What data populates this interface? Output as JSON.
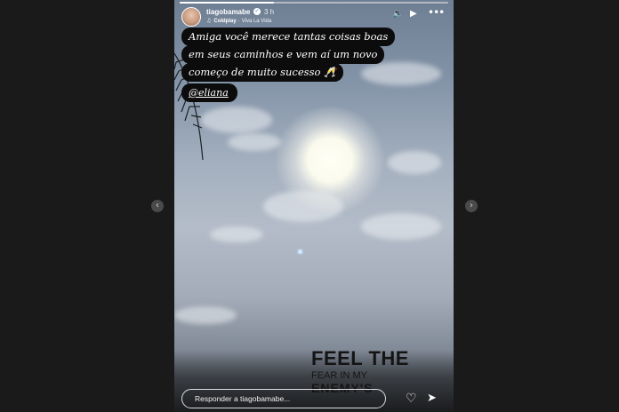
{
  "navigation": {
    "prev_icon": "chevron-left-icon",
    "next_icon": "chevron-right-icon",
    "prev_glyph": "‹",
    "next_glyph": "›"
  },
  "story": {
    "progress_fraction": 0.35,
    "header": {
      "username": "tiagobamabe",
      "verified_glyph": "✓",
      "time_ago": "3 h",
      "music": {
        "icon_glyph": "♫",
        "artist": "Coldplay",
        "separator": "·",
        "track": "Viva La Vida"
      },
      "sound_glyph": "🔈",
      "play_glyph": "▶",
      "more_glyph": "•••"
    },
    "caption_lines": [
      "Amiga você merece tantas coisas boas",
      "em seus caminhos e vem aí um novo",
      "começo de muito sucesso 🥂"
    ],
    "mention": "@eliana",
    "overlay_text": {
      "title": "FEEL THE",
      "line2": "FEAR IN MY",
      "line3": "ENEMY'S"
    },
    "reply": {
      "placeholder": "Responder a tiagobamabe...",
      "heart_glyph": "♡",
      "send_glyph": "➤"
    }
  },
  "colors": {
    "background": "#1a1a1a",
    "caption_bg": "#0c0c0c",
    "overlay_text": "#141414"
  }
}
